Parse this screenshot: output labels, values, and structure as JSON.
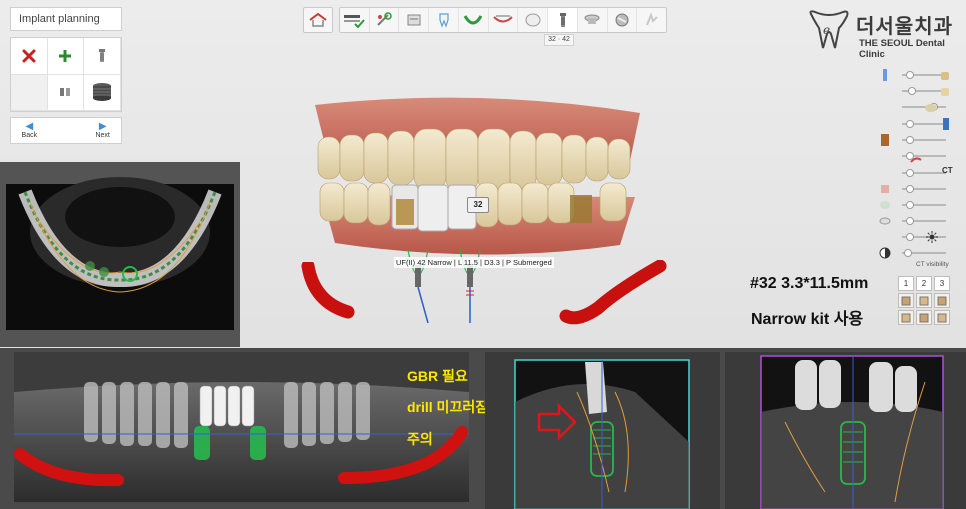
{
  "panel": {
    "title": "Implant planning",
    "back_label": "Back",
    "next_label": "Next",
    "tools": [
      "delete-icon",
      "add-icon",
      "implant-icon",
      "",
      "implant-pair-icon",
      "abutment-icon"
    ]
  },
  "toolbar": {
    "home_icon": "home-icon",
    "steps": [
      "scan-check-icon",
      "tools-icon",
      "model-icon",
      "tooth-icon",
      "arch-icon",
      "mandible-icon",
      "crown-icon",
      "implant-icon",
      "sleeve-icon",
      "guide-icon",
      "export-icon"
    ],
    "active_step_label": "32 · 42"
  },
  "logo": {
    "korean": "더서울치과",
    "english": "THE SEOUL Dental Clinic"
  },
  "sliders": {
    "ct_tag": "CT",
    "ct_visibility": "CT visibility",
    "values": [
      0.1,
      0.15,
      0.7,
      0.1,
      0.1,
      0.1,
      0.1,
      0.1,
      0.1,
      0.1,
      0.1
    ]
  },
  "view_options": {
    "numbers": [
      "1",
      "2",
      "3"
    ]
  },
  "implant_label": {
    "info": "UF(II) 42 Narrow | L 11.5 | D3.3 | P Submerged",
    "tooth_number": "32"
  },
  "annotations": {
    "implant_spec": "#32 3.3*11.5mm",
    "kit_note": "Narrow kit 사용",
    "gbr_note": "GBR 필요",
    "drill_note": "drill 미끄러짐",
    "caution_note": "주의"
  },
  "colors": {
    "accent_red": "#d0110f",
    "implant_green": "#27b84a",
    "note_yellow": "#ffe800",
    "cross_section_cyan": "#3fd9d0",
    "cross_section_purple": "#b04fd8"
  }
}
